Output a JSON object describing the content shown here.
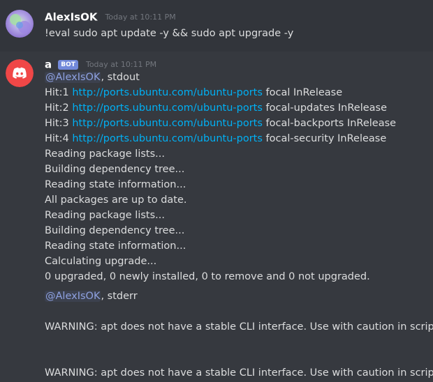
{
  "user_message": {
    "username": "AlexIsOK",
    "timestamp": "Today at 10:11 PM",
    "content": "!eval sudo apt update -y && sudo apt upgrade -y"
  },
  "bot_message": {
    "username": "a",
    "bot_tag": "BOT",
    "timestamp": "Today at 10:11 PM",
    "stdout_mention": "@AlexIsOK",
    "stdout_label": ", stdout",
    "hits": [
      {
        "prefix": "Hit:1 ",
        "url": "http://ports.ubuntu.com/ubuntu-ports",
        "suffix": " focal InRelease"
      },
      {
        "prefix": "Hit:2 ",
        "url": "http://ports.ubuntu.com/ubuntu-ports",
        "suffix": " focal-updates InRelease"
      },
      {
        "prefix": "Hit:3 ",
        "url": "http://ports.ubuntu.com/ubuntu-ports",
        "suffix": " focal-backports InRelease"
      },
      {
        "prefix": "Hit:4 ",
        "url": "http://ports.ubuntu.com/ubuntu-ports",
        "suffix": " focal-security InRelease"
      }
    ],
    "lines": [
      "Reading package lists...",
      "Building dependency tree...",
      "Reading state information...",
      "All packages are up to date.",
      "Reading package lists...",
      "Building dependency tree...",
      "Reading state information...",
      "Calculating upgrade...",
      "0 upgraded, 0 newly installed, 0 to remove and 0 not upgraded."
    ],
    "stderr_mention": "@AlexIsOK",
    "stderr_label": ", stderr",
    "warnings": [
      "WARNING: apt does not have a stable CLI interface. Use with caution in scripts.",
      "WARNING: apt does not have a stable CLI interface. Use with caution in scripts."
    ]
  },
  "colors": {
    "background": "#36393f",
    "hover_background": "#32353b",
    "text": "#dcddde",
    "username": "#ffffff",
    "timestamp": "#72767d",
    "mention": "#8ea1e1",
    "link": "#00b0f4",
    "bot_tag": "#7289da",
    "bot_avatar": "#f04747"
  },
  "icons": {
    "user_avatar": "avatar-image",
    "bot_avatar": "discord-logo-icon"
  }
}
